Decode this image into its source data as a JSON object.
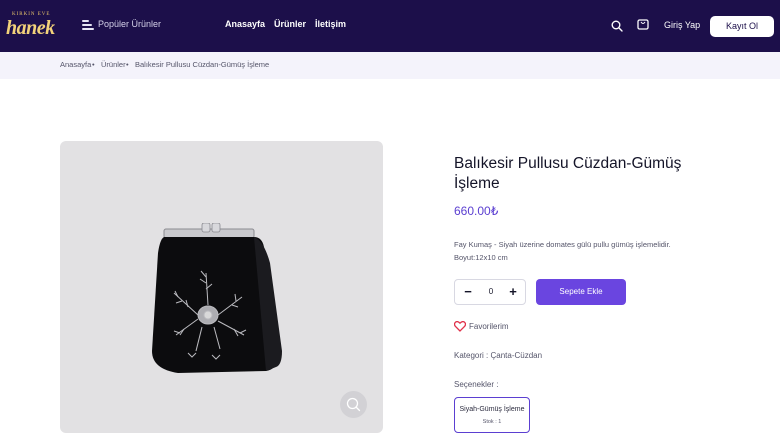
{
  "header": {
    "logo_top": "KIRKIN EVE",
    "logo_main": "hanek",
    "popular_label": "Popüler Ürünler",
    "nav": [
      "Anasayfa",
      "Ürünler",
      "İletişim"
    ],
    "login_label": "Giriş Yap",
    "register_label": "Kayıt Ol"
  },
  "breadcrumb": [
    "Anasayfa",
    "Ürünler",
    "Balıkesir Pullusu Cüzdan-Gümüş İşleme"
  ],
  "product": {
    "title": "Balıkesir Pullusu Cüzdan-Gümüş İşleme",
    "price": "660.00₺",
    "description_line1": "Fay Kumaş - Siyah üzerine domates gülü pullu gümüş işlemelidir.",
    "description_line2": "Boyut:12x10 cm",
    "quantity": "0",
    "minus_label": "−",
    "plus_label": "+",
    "add_to_cart_label": "Sepete Ekle",
    "favorites_label": "Favorilerim",
    "category_text": "Kategori : Çanta-Cüzdan",
    "options_label": "Seçenekler :",
    "option": {
      "name": "Siyah-Gümüş İşleme",
      "stock": "Stok : 1"
    }
  },
  "colors": {
    "header_bg": "#1c0f4a",
    "accent": "#6a45e0",
    "price": "#5b3fd1",
    "heart": "#e0324b"
  },
  "icons": [
    "menu-icon",
    "search-icon",
    "bag-icon",
    "heart-icon",
    "zoom-icon"
  ]
}
